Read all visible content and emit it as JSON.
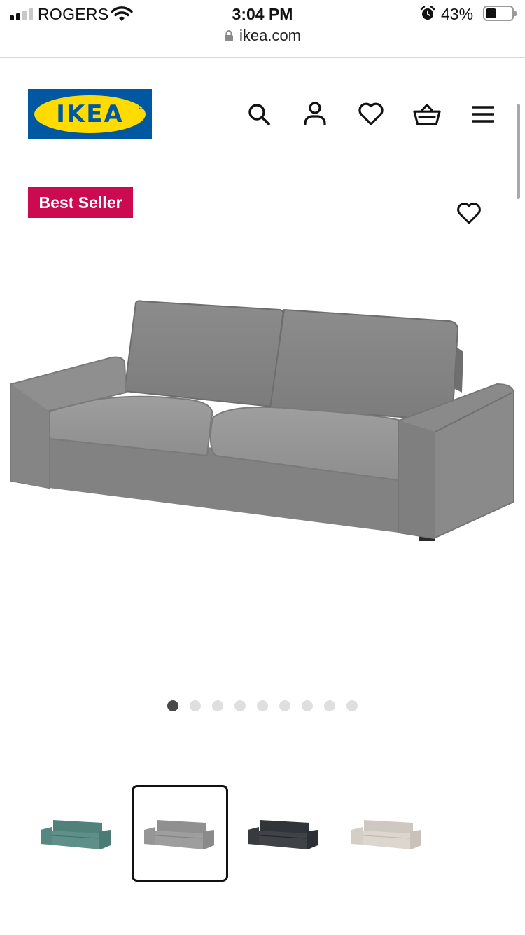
{
  "status_bar": {
    "carrier": "ROGERS",
    "time": "3:04 PM",
    "battery_percent": "43%",
    "battery_level": 0.43,
    "icons": [
      "signal-icon",
      "wifi-icon",
      "alarm-icon",
      "battery-icon"
    ]
  },
  "browser": {
    "url": "ikea.com",
    "icons": [
      "lock-icon"
    ]
  },
  "header": {
    "logo_text": "IKEA",
    "icons": [
      "search-icon",
      "user-icon",
      "heart-icon",
      "basket-icon",
      "menu-icon"
    ]
  },
  "product": {
    "badge": "Best Seller",
    "favorite_icon": "heart-outline-icon",
    "image": "grey-sofa",
    "carousel": {
      "count": 9,
      "active_index": 0
    },
    "colors": [
      {
        "name": "teal",
        "hex": "#5e8f89",
        "selected": false
      },
      {
        "name": "grey",
        "hex": "#9e9e9e",
        "selected": true
      },
      {
        "name": "dark-grey",
        "hex": "#3f4246",
        "selected": false
      },
      {
        "name": "beige",
        "hex": "#dcd6cf",
        "selected": false
      }
    ]
  },
  "theme": {
    "ikea_blue": "#0058a3",
    "ikea_yellow": "#ffdb00",
    "badge_red": "#cc0a4f",
    "text": "#111111"
  }
}
